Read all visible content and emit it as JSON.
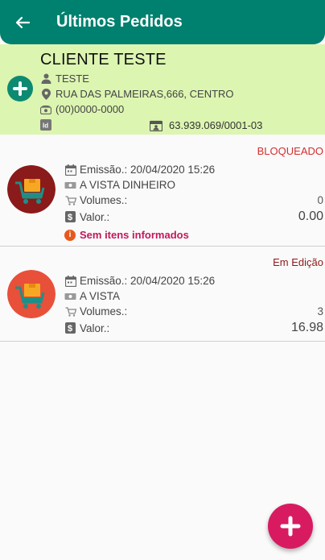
{
  "appbar": {
    "title": "Últimos Pedidos"
  },
  "client": {
    "name": "CLIENTE TESTE",
    "contact": "TESTE",
    "address": "RUA DAS PALMEIRAS,666, CENTRO",
    "phone": "(00)0000-0000",
    "cnpj": "63.939.069/0001-03"
  },
  "orders": [
    {
      "status": "BLOQUEADO",
      "status_color": "#d32f2f",
      "emissao_label": "Emissão.:",
      "emissao": "20/04/2020 15:26",
      "payment": "A VISTA DINHEIRO",
      "volumes_label": "Volumes.:",
      "volumes": "0",
      "valor_label": "Valor.:",
      "valor": "0.00",
      "warning": "Sem itens informados",
      "avatar_color": "#8b1a1a"
    },
    {
      "status": "Em Edição",
      "status_color": "#8b1a1a",
      "emissao_label": "Emissão.:",
      "emissao": "20/04/2020 15:26",
      "payment": "A VISTA",
      "volumes_label": "Volumes.:",
      "volumes": "3",
      "valor_label": "Valor.:",
      "valor": "16.98",
      "avatar_color": "#e8503a"
    }
  ],
  "colors": {
    "appbar": "#00806e",
    "client_bg": "#dcf5b1",
    "fab": "#d81b60"
  }
}
